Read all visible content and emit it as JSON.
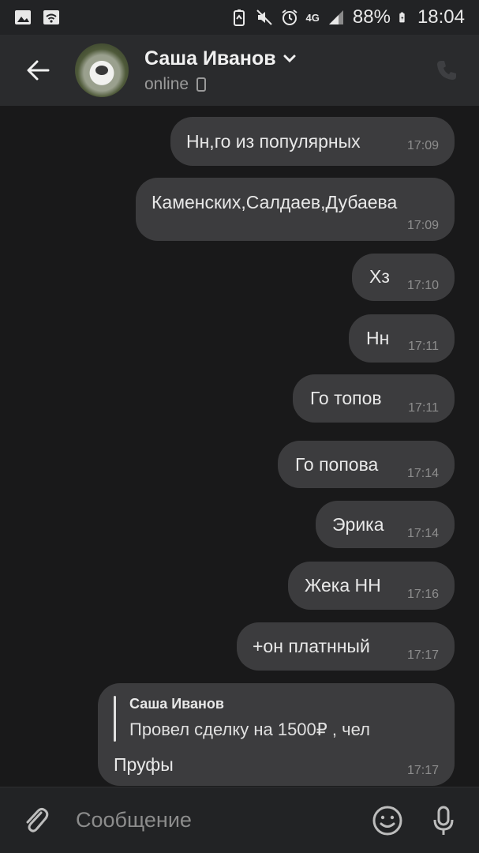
{
  "status_bar": {
    "battery": "88%",
    "network": "4G",
    "time": "18:04",
    "icons": [
      "image-icon",
      "wifi-icon",
      "battery-saver-icon",
      "mute-icon",
      "alarm-icon",
      "signal-icon",
      "battery-icon"
    ]
  },
  "header": {
    "name": "Саша Иванов",
    "status": "online",
    "icons": [
      "back-arrow-icon",
      "chevron-down-icon",
      "mobile-device-icon",
      "phone-icon"
    ]
  },
  "messages": [
    {
      "text": "Нн,го из популярных",
      "time": "17:09"
    },
    {
      "text": "Каменских,Салдаев,Дубаева",
      "time": "17:09"
    },
    {
      "text": "Хз",
      "time": "17:10"
    },
    {
      "text": "Нн",
      "time": "17:11"
    },
    {
      "text": "Го топов",
      "time": "17:11"
    },
    {
      "text": "Го попова",
      "time": "17:14"
    },
    {
      "text": "Эрика",
      "time": "17:14"
    },
    {
      "text": "Жека НН",
      "time": "17:16"
    },
    {
      "text": "+он платнный",
      "time": "17:17"
    }
  ],
  "reply_message": {
    "quoted_author": "Саша Иванов",
    "quoted_text": "Провел сделку на 1500₽ , чел",
    "text": "Пруфы",
    "time": "17:17"
  },
  "composer": {
    "placeholder": "Сообщение",
    "icons": [
      "attach-icon",
      "emoji-icon",
      "microphone-icon"
    ]
  },
  "colors": {
    "background": "#19191a",
    "header": "#2a2b2d",
    "bubble": "#3c3c3e",
    "time_text": "#8d8d8d"
  }
}
